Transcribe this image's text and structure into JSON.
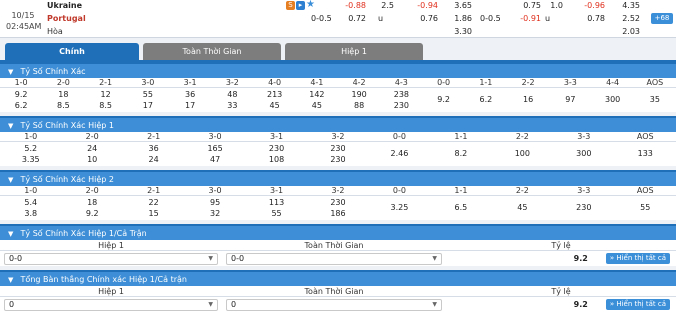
{
  "match": {
    "date": "10/15",
    "time": "02:45AM",
    "home": "Ukraine",
    "away": "Portugal",
    "draw": "Hòa",
    "row1": [
      "-0.88",
      "2.5",
      "-0.94",
      "3.65",
      "0.75",
      "1.0",
      "-0.96",
      "4.35"
    ],
    "row2": [
      "0-0.5",
      "0.72",
      "u",
      "0.76",
      "1.86",
      "0-0.5",
      "-0.91",
      "u",
      "0.78",
      "2.52"
    ],
    "row3": [
      "3.30",
      "2.03"
    ],
    "more_badge": "+68"
  },
  "tabs": [
    "Chính",
    "Toàn Thời Gian",
    "Hiệp 1"
  ],
  "sections": {
    "s1": {
      "title": "Tỷ Số Chính Xác",
      "headers": [
        "1-0",
        "2-0",
        "2-1",
        "3-0",
        "3-1",
        "3-2",
        "4-0",
        "4-1",
        "4-2",
        "4-3",
        "0-0",
        "1-1",
        "2-2",
        "3-3",
        "4-4",
        "AOS"
      ],
      "top": [
        "9.2",
        "18",
        "12",
        "55",
        "36",
        "48",
        "213",
        "142",
        "190",
        "238",
        "9.2",
        "6.2",
        "16",
        "97",
        "300",
        "35"
      ],
      "bottom": [
        "6.2",
        "8.5",
        "8.5",
        "17",
        "17",
        "33",
        "45",
        "45",
        "88",
        "230",
        "",
        "",
        "",
        "",
        "",
        ""
      ]
    },
    "s2": {
      "title": "Tỷ Số Chính Xác Hiệp 1",
      "headers": [
        "1-0",
        "2-0",
        "2-1",
        "3-0",
        "3-1",
        "3-2",
        "0-0",
        "1-1",
        "2-2",
        "3-3",
        "AOS"
      ],
      "top": [
        "5.2",
        "24",
        "36",
        "165",
        "230",
        "230",
        "2.46",
        "8.2",
        "100",
        "300",
        "133"
      ],
      "bottom": [
        "3.35",
        "10",
        "24",
        "47",
        "108",
        "230",
        "",
        "",
        "",
        "",
        ""
      ]
    },
    "s3": {
      "title": "Tỷ Số Chính Xác Hiệp 2",
      "headers": [
        "1-0",
        "2-0",
        "2-1",
        "3-0",
        "3-1",
        "3-2",
        "0-0",
        "1-1",
        "2-2",
        "3-3",
        "AOS"
      ],
      "top": [
        "5.4",
        "18",
        "22",
        "95",
        "113",
        "230",
        "3.25",
        "6.5",
        "45",
        "230",
        "55"
      ],
      "bottom": [
        "3.8",
        "9.2",
        "15",
        "32",
        "55",
        "186",
        "",
        "",
        "",
        "",
        ""
      ]
    },
    "s4": {
      "title": "Tỷ Số Chính Xác Hiệp 1/Cả Trận",
      "col1": "Hiệp 1",
      "col2": "Toàn Thời Gian",
      "col3": "Tỷ lệ",
      "sel1": "0-0",
      "sel2": "0-0",
      "ratio": "9.2",
      "button": "Hiển thị tất cả"
    },
    "s5": {
      "title": "Tổng Bàn thắng Chính xác Hiệp 1/Cả trận",
      "col1": "Hiệp 1",
      "col2": "Toàn Thời Gian",
      "col3": "Tỷ lệ",
      "sel1": "0",
      "sel2": "0",
      "ratio": "9.2",
      "button": "Hiển thị tất cả"
    }
  }
}
